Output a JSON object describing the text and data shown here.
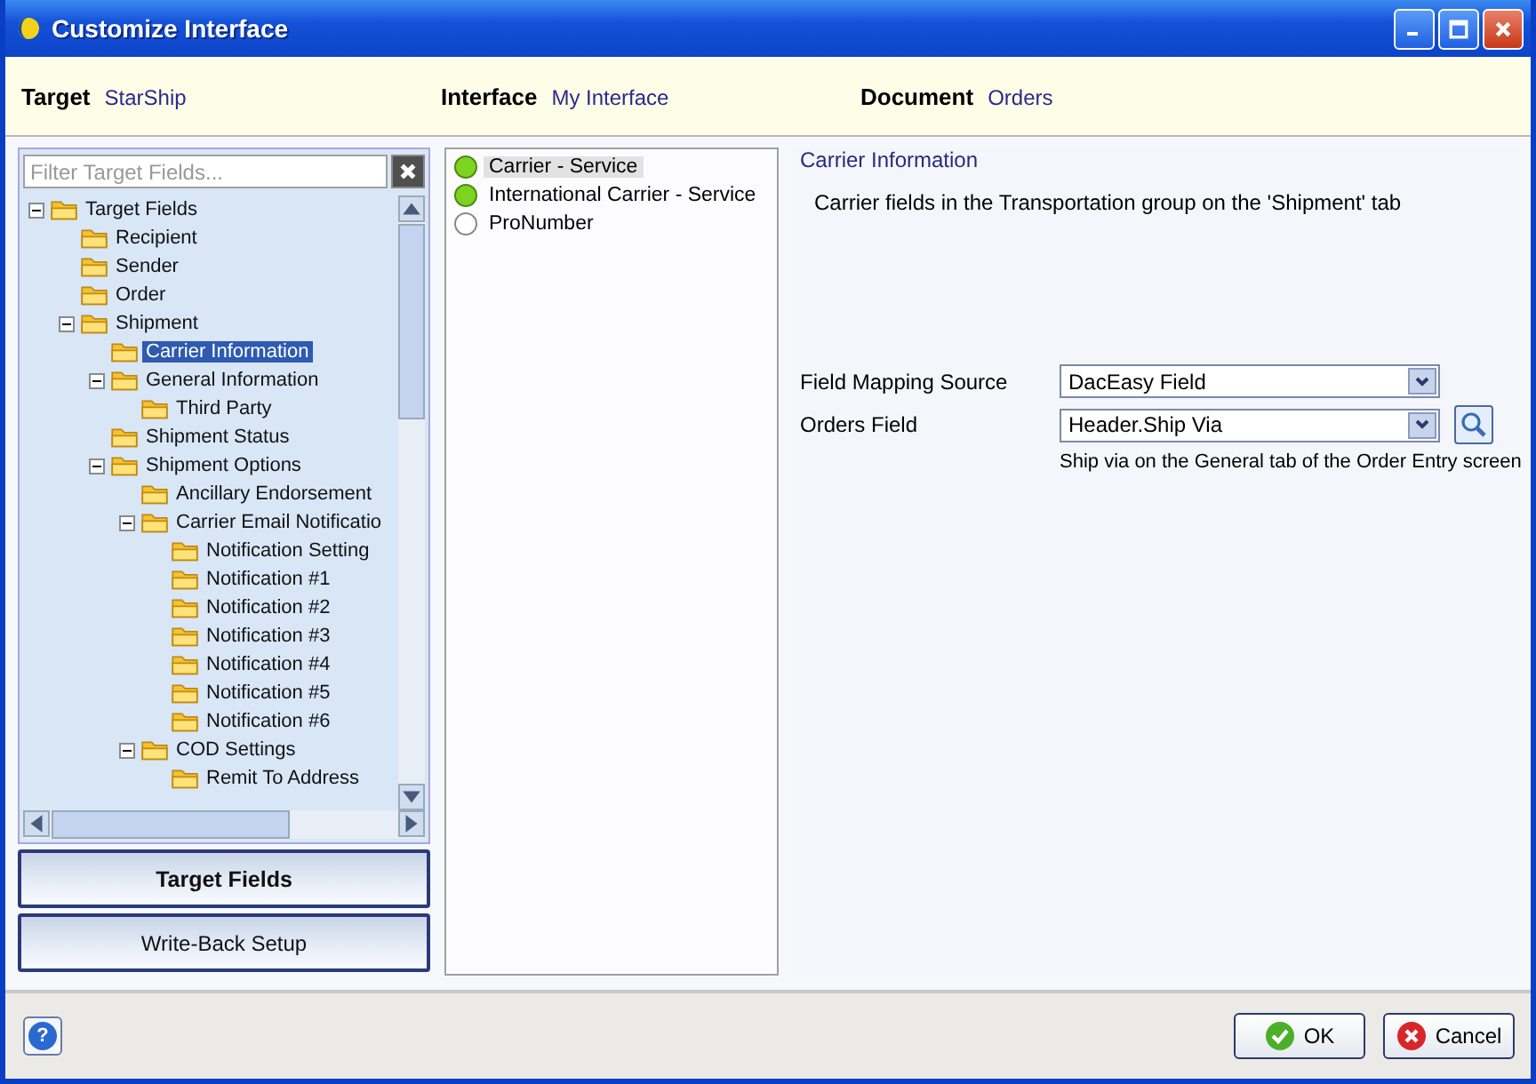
{
  "window": {
    "title": "Customize Interface"
  },
  "header": [
    {
      "label": "Target",
      "value": "StarShip"
    },
    {
      "label": "Interface",
      "value": "My Interface"
    },
    {
      "label": "Document",
      "value": "Orders"
    }
  ],
  "filter": {
    "placeholder": "Filter Target Fields..."
  },
  "tree": [
    {
      "label": "Target Fields",
      "selected": false,
      "expanded": true,
      "children": [
        {
          "label": "Recipient",
          "selected": false
        },
        {
          "label": "Sender",
          "selected": false
        },
        {
          "label": "Order",
          "selected": false
        },
        {
          "label": "Shipment",
          "selected": false,
          "expanded": true,
          "children": [
            {
              "label": "Carrier Information",
              "selected": true
            },
            {
              "label": "General Information",
              "selected": false,
              "expanded": true,
              "children": [
                {
                  "label": "Third Party",
                  "selected": false
                }
              ]
            },
            {
              "label": "Shipment Status",
              "selected": false
            },
            {
              "label": "Shipment Options",
              "selected": false,
              "expanded": true,
              "children": [
                {
                  "label": "Ancillary Endorsement",
                  "selected": false
                },
                {
                  "label": "Carrier Email Notificatio",
                  "selected": false,
                  "expanded": true,
                  "children": [
                    {
                      "label": "Notification Setting",
                      "selected": false
                    },
                    {
                      "label": "Notification #1",
                      "selected": false
                    },
                    {
                      "label": "Notification #2",
                      "selected": false
                    },
                    {
                      "label": "Notification #3",
                      "selected": false
                    },
                    {
                      "label": "Notification #4",
                      "selected": false
                    },
                    {
                      "label": "Notification #5",
                      "selected": false
                    },
                    {
                      "label": "Notification #6",
                      "selected": false
                    }
                  ]
                },
                {
                  "label": "COD Settings",
                  "selected": false,
                  "expanded": true,
                  "children": [
                    {
                      "label": "Remit To Address",
                      "selected": false
                    }
                  ]
                }
              ]
            }
          ]
        }
      ]
    }
  ],
  "left_tabs": [
    {
      "label": "Target Fields",
      "selected": true
    },
    {
      "label": "Write-Back Setup",
      "selected": false
    }
  ],
  "fields": [
    {
      "label": "Carrier - Service",
      "mapped": true,
      "selected": true
    },
    {
      "label": "International Carrier - Service",
      "mapped": true,
      "selected": false
    },
    {
      "label": "ProNumber",
      "mapped": false,
      "selected": false
    }
  ],
  "detail": {
    "title": "Carrier Information",
    "description": "Carrier fields in the Transportation group on the 'Shipment' tab",
    "rows": [
      {
        "kind": "dropdown",
        "label": "Field Mapping Source",
        "value": "DacEasy Field"
      },
      {
        "kind": "lookup",
        "label": "Orders Field",
        "value": "Header.Ship Via"
      }
    ],
    "hint": "Ship via on the General tab of the Order Entry screen"
  },
  "help_button": {
    "label": "?"
  },
  "buttons": [
    {
      "kind": "ok",
      "label": "OK"
    },
    {
      "kind": "cancel",
      "label": "Cancel"
    }
  ]
}
